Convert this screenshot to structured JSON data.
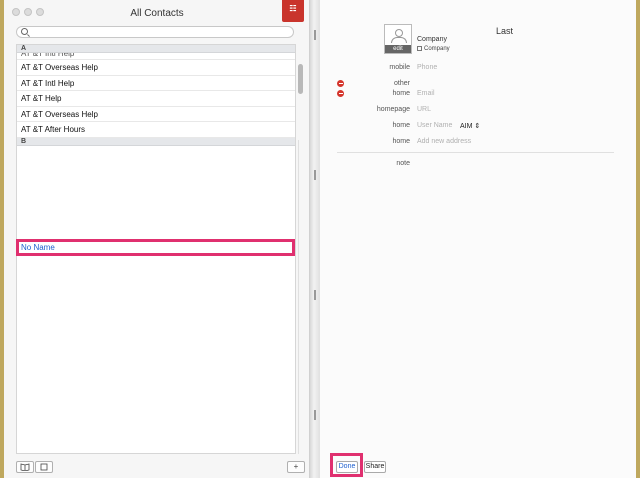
{
  "window": {
    "title": "All Contacts",
    "bookmark_glyph": "☷",
    "accent": "#e0306f"
  },
  "search": {
    "placeholder": "",
    "value": ""
  },
  "contact_list": {
    "sections": [
      {
        "letter": "A"
      },
      {
        "letter": "B"
      }
    ],
    "partial_top": "AT &T Intl Help",
    "rows": [
      "AT &T Overseas Help",
      "AT &T Intl Help",
      "AT &T Help",
      "AT &T Overseas Help",
      "AT &T After Hours"
    ],
    "selected_row": "No Name"
  },
  "left_toolbar": {
    "add_label": "+"
  },
  "card": {
    "photo_edit_label": "edit",
    "last_name": "Last",
    "company": "Company",
    "company_checkbox_label": "Company",
    "fields": {
      "mobile_label": "mobile",
      "mobile_placeholder": "Phone",
      "other_label": "other",
      "home_email_label": "home",
      "email_placeholder": "Email",
      "homepage_label": "homepage",
      "url_placeholder": "URL",
      "im_label": "home",
      "username_placeholder": "User Name",
      "im_service": "AIM",
      "address_label": "home",
      "address_placeholder": "Add new address",
      "note_label": "note"
    }
  },
  "footer": {
    "done_label": "Done",
    "share_label": "Share"
  },
  "icons": [
    "search-icon",
    "bookmark-icon",
    "book-icon",
    "square-icon",
    "add-icon",
    "minus-icon",
    "avatar-icon"
  ]
}
